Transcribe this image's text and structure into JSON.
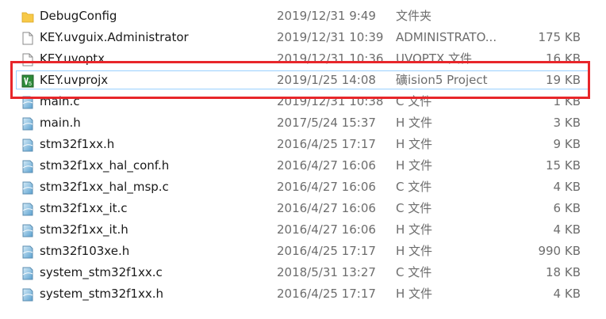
{
  "files": [
    {
      "name": "DebugConfig",
      "date": "2019/12/31 9:49",
      "type": "文件夹",
      "size": "",
      "icon": "folder-icon"
    },
    {
      "name": "KEY.uvguix.Administrator",
      "date": "2019/12/31 10:39",
      "type": "ADMINISTRATO...",
      "size": "175 KB",
      "icon": "blank-file-icon"
    },
    {
      "name": "KEY.uvoptx",
      "date": "2019/12/31 10:36",
      "type": "UVOPTX 文件",
      "size": "16 KB",
      "icon": "blank-file-icon"
    },
    {
      "name": "KEY.uvprojx",
      "date": "2019/1/25 14:08",
      "type": "礦ision5 Project",
      "size": "19 KB",
      "icon": "keil-project-icon"
    },
    {
      "name": "main.c",
      "date": "2019/12/31 10:38",
      "type": "C 文件",
      "size": "1 KB",
      "icon": "source-file-icon"
    },
    {
      "name": "main.h",
      "date": "2017/5/24 15:37",
      "type": "H 文件",
      "size": "3 KB",
      "icon": "source-file-icon"
    },
    {
      "name": "stm32f1xx.h",
      "date": "2016/4/25 17:17",
      "type": "H 文件",
      "size": "9 KB",
      "icon": "source-file-icon"
    },
    {
      "name": "stm32f1xx_hal_conf.h",
      "date": "2016/4/27 16:06",
      "type": "H 文件",
      "size": "15 KB",
      "icon": "source-file-icon"
    },
    {
      "name": "stm32f1xx_hal_msp.c",
      "date": "2016/4/27 16:06",
      "type": "C 文件",
      "size": "4 KB",
      "icon": "source-file-icon"
    },
    {
      "name": "stm32f1xx_it.c",
      "date": "2016/4/27 16:06",
      "type": "C 文件",
      "size": "6 KB",
      "icon": "source-file-icon"
    },
    {
      "name": "stm32f1xx_it.h",
      "date": "2016/4/27 16:06",
      "type": "H 文件",
      "size": "4 KB",
      "icon": "source-file-icon"
    },
    {
      "name": "stm32f103xe.h",
      "date": "2016/4/25 17:17",
      "type": "H 文件",
      "size": "990 KB",
      "icon": "source-file-icon"
    },
    {
      "name": "system_stm32f1xx.c",
      "date": "2018/5/31 13:27",
      "type": "C 文件",
      "size": "18 KB",
      "icon": "source-file-icon"
    },
    {
      "name": "system_stm32f1xx.h",
      "date": "2016/4/25 17:17",
      "type": "H 文件",
      "size": "4 KB",
      "icon": "source-file-icon"
    }
  ],
  "selected_index": 3,
  "colors": {
    "highlight_border": "#e8262a",
    "selection_border": "#99d1ff",
    "folder": "#f7c948",
    "keil_green": "#2e8b3a"
  }
}
